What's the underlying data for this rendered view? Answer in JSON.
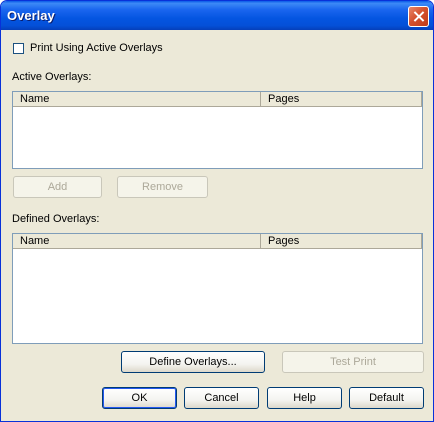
{
  "window": {
    "title": "Overlay"
  },
  "print_using_active": {
    "label": "Print Using Active Overlays",
    "checked": false
  },
  "active_overlays": {
    "label": "Active Overlays:",
    "columns": [
      "Name",
      "Pages"
    ],
    "rows": [],
    "add_label": "Add",
    "remove_label": "Remove"
  },
  "defined_overlays": {
    "label": "Defined Overlays:",
    "columns": [
      "Name",
      "Pages"
    ],
    "rows": [],
    "define_label": "Define Overlays...",
    "test_print_label": "Test Print"
  },
  "footer": {
    "ok": "OK",
    "cancel": "Cancel",
    "help": "Help",
    "default": "Default"
  }
}
